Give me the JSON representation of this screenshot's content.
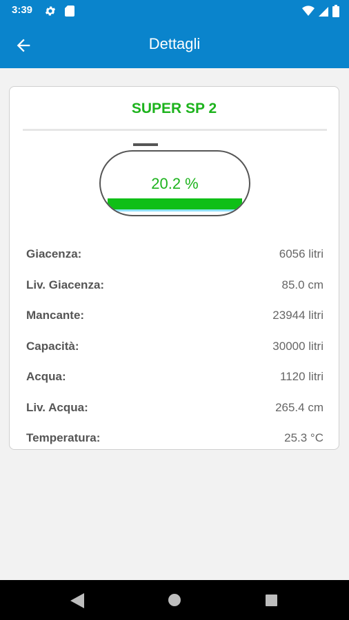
{
  "status_bar": {
    "time": "3:39",
    "icons": [
      "gear-icon",
      "sd-card-icon",
      "wifi-icon",
      "signal-icon",
      "battery-icon"
    ]
  },
  "app_bar": {
    "title": "Dettagli",
    "back_icon": "arrow-back-icon",
    "color": "#0a84cc"
  },
  "tank": {
    "name": "SUPER SP 2",
    "fill_percent": 20.2,
    "percent_label": "20.2 %",
    "accent_color": "#1db31d"
  },
  "details": [
    {
      "label": "Giacenza:",
      "value": "6056 litri"
    },
    {
      "label": "Liv. Giacenza:",
      "value": "85.0 cm"
    },
    {
      "label": "Mancante:",
      "value": "23944 litri"
    },
    {
      "label": "Capacità:",
      "value": "30000 litri"
    },
    {
      "label": "Acqua:",
      "value": "1120 litri"
    },
    {
      "label": "Liv. Acqua:",
      "value": "265.4 cm"
    },
    {
      "label": "Temperatura:",
      "value": "25.3 °C"
    }
  ],
  "nav_bar": {
    "icons": [
      "nav-back-icon",
      "nav-home-icon",
      "nav-recents-icon"
    ]
  }
}
